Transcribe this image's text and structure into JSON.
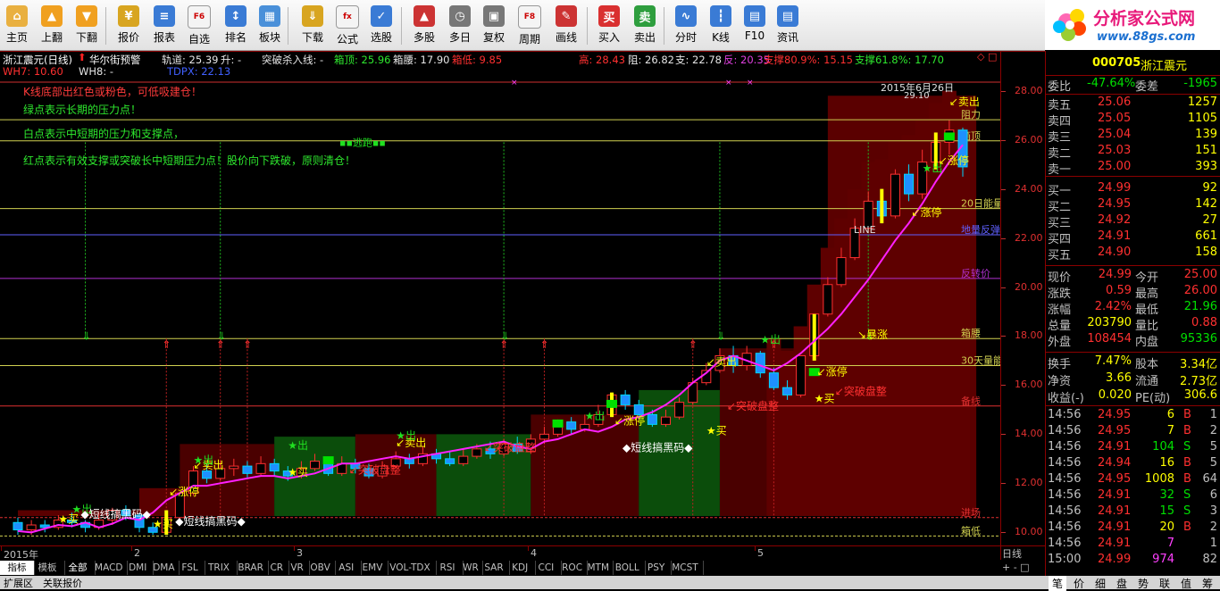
{
  "toolbar": {
    "buttons": [
      {
        "label": "主页",
        "icon": "home-icon",
        "color": "#e9b040",
        "glyph": "⌂"
      },
      {
        "label": "上翻",
        "icon": "arrow-up-icon",
        "color": "#f0a020",
        "glyph": "▲"
      },
      {
        "label": "下翻",
        "icon": "arrow-down-icon",
        "color": "#f0a020",
        "glyph": "▼"
      },
      {
        "label": "报价",
        "icon": "price-icon",
        "color": "#d8a520",
        "glyph": "¥"
      },
      {
        "label": "报表",
        "icon": "report-icon",
        "color": "#3a7bd5",
        "glyph": "≡"
      },
      {
        "label": "自选",
        "icon": "f6-icon",
        "color": "#c0c0c0",
        "glyph": "F6"
      },
      {
        "label": "排名",
        "icon": "rank-icon",
        "color": "#3a7bd5",
        "glyph": "↕"
      },
      {
        "label": "板块",
        "icon": "sector-icon",
        "color": "#4a90d9",
        "glyph": "▦"
      },
      {
        "label": "下载",
        "icon": "download-icon",
        "color": "#d8a520",
        "glyph": "⇓"
      },
      {
        "label": "公式",
        "icon": "formula-icon",
        "color": "#e9b040",
        "glyph": "fx"
      },
      {
        "label": "选股",
        "icon": "stock-picker-icon",
        "color": "#3a7bd5",
        "glyph": "✓"
      },
      {
        "label": "多股",
        "icon": "multi-stock-icon",
        "color": "#cc3333",
        "glyph": "▲"
      },
      {
        "label": "多日",
        "icon": "multi-day-icon",
        "color": "#777777",
        "glyph": "◷"
      },
      {
        "label": "复权",
        "icon": "adjust-icon",
        "color": "#777777",
        "glyph": "▣"
      },
      {
        "label": "周期",
        "icon": "f8-icon",
        "color": "#c0c0c0",
        "glyph": "F8"
      },
      {
        "label": "画线",
        "icon": "draw-line-icon",
        "color": "#cc3333",
        "glyph": "✎"
      },
      {
        "label": "买入",
        "icon": "buy-icon",
        "color": "#d93030",
        "glyph": "买"
      },
      {
        "label": "卖出",
        "icon": "sell-icon",
        "color": "#2e9e3e",
        "glyph": "卖"
      },
      {
        "label": "分时",
        "icon": "intraday-icon",
        "color": "#3a7bd5",
        "glyph": "∿"
      },
      {
        "label": "K线",
        "icon": "kline-icon",
        "color": "#3a7bd5",
        "glyph": "┇"
      },
      {
        "label": "F10",
        "icon": "f10-icon",
        "color": "#3a7bd5",
        "glyph": "▤"
      },
      {
        "label": "资讯",
        "icon": "news-icon",
        "color": "#3a7bd5",
        "glyph": "▤"
      }
    ]
  },
  "logo": {
    "title": "分析家公式网",
    "url": "www.88gs.com"
  },
  "infobar": {
    "stock_title": "浙江震元(日线)",
    "indicator_name": "华尔街预警",
    "track_label": "轨道: 25.39",
    "rise_label": "升: -",
    "break_label": "突破杀入线: -",
    "box_top_label": "箱顶: 25.96",
    "box_waist_label": "箱腰: 17.90",
    "box_bottom_label": "箱低: 9.85",
    "high_label": "高: 28.43",
    "resist_label": "阻: 26.82",
    "support_label": "支: 22.78",
    "rebound_label": "反: 20.35",
    "support80_label": "支撑80.9%: 15.15",
    "support61_label": "支撑61.8%: 17.70",
    "wh7_label": "WH7: 10.60",
    "wh8_label": "WH8: -",
    "tdpx_label": "TDPX: 22.13"
  },
  "notes": [
    {
      "text": "K线底部出红色或粉色，可低吸建仓！",
      "color": "#ff3b3b"
    },
    {
      "text": "绿点表示长期的压力点！",
      "color": "#2ee82e"
    },
    {
      "text": "白点表示中短期的压力和支撑点，",
      "color": "#2ee82e"
    },
    {
      "text": "红点表示有效支撑或突破长中短期压力点！股价向下跌破，原则清仓！",
      "color": "#2ee82e"
    }
  ],
  "chart_data": {
    "type": "candlestick",
    "x_labels": [
      "2015年",
      "2",
      "3",
      "4",
      "5"
    ],
    "ylim": [
      9.5,
      28.5
    ],
    "y_ticks": [
      10.0,
      12.0,
      14.0,
      16.0,
      18.0,
      20.0,
      22.0,
      24.0,
      26.0,
      28.0
    ],
    "date_annotation": "2015年6月26日",
    "date_annotation_value": "29.10",
    "levels": [
      {
        "name": "阻力",
        "value": 26.82,
        "color": "#d0d050"
      },
      {
        "name": "箱顶",
        "value": 25.96,
        "color": "#d0d050"
      },
      {
        "name": "20日能量",
        "value": 23.2,
        "color": "#d0d050"
      },
      {
        "name": "地量反弹",
        "value": 22.13,
        "color": "#6060ff"
      },
      {
        "name": "反转价",
        "value": 20.35,
        "color": "#b030d0"
      },
      {
        "name": "箱腰",
        "value": 17.9,
        "color": "#d0d050"
      },
      {
        "name": "30天量能",
        "value": 16.8,
        "color": "#d0d050"
      },
      {
        "name": "备线",
        "value": 15.15,
        "color": "#e03030"
      },
      {
        "name": "进场",
        "value": 10.6,
        "color": "#e03030"
      },
      {
        "name": "箱低",
        "value": 9.85,
        "color": "#d0d050"
      }
    ],
    "series": [
      {
        "name": "轨道",
        "values": [
          10.05,
          10.0,
          10.15,
          10.3,
          10.25,
          10.4,
          10.2,
          10.35,
          10.6,
          10.5,
          10.8,
          11.3,
          11.6,
          11.9,
          11.9,
          12.0,
          12.1,
          12.2,
          12.3,
          12.3,
          12.2,
          12.3,
          12.4,
          12.6,
          12.8,
          12.8,
          12.9,
          13.0,
          13.1,
          13.0,
          13.1,
          13.2,
          13.3,
          13.4,
          13.5,
          13.6,
          13.7,
          13.5,
          13.4,
          13.7,
          13.8,
          14.0,
          14.2,
          14.1,
          14.3,
          14.6,
          14.7,
          14.9,
          15.2,
          15.6,
          16.1,
          16.5,
          17.0,
          17.2,
          17.0,
          16.8,
          16.6,
          16.9,
          17.3,
          17.8,
          18.3,
          18.9,
          19.6,
          20.3,
          21.1,
          21.9,
          22.6,
          23.4,
          24.3,
          25.1,
          25.8
        ]
      }
    ],
    "candles": [
      [
        10.4,
        10.1,
        10.6,
        9.9
      ],
      [
        10.1,
        10.3,
        10.5,
        9.9
      ],
      [
        10.3,
        10.2,
        10.5,
        10.0
      ],
      [
        10.2,
        10.5,
        10.7,
        10.1
      ],
      [
        10.5,
        10.4,
        10.8,
        10.2
      ],
      [
        10.4,
        10.2,
        10.5,
        10.0
      ],
      [
        10.2,
        10.5,
        10.8,
        10.1
      ],
      [
        10.5,
        10.9,
        11.0,
        10.3
      ],
      [
        10.9,
        10.7,
        11.1,
        10.5
      ],
      [
        10.7,
        10.2,
        10.8,
        10.0
      ],
      [
        10.2,
        10.0,
        10.4,
        9.9
      ],
      [
        10.0,
        10.6,
        10.9,
        9.9
      ],
      [
        10.6,
        11.6,
        11.6,
        10.5
      ],
      [
        11.6,
        12.5,
        12.7,
        11.5
      ],
      [
        12.5,
        12.2,
        12.8,
        12.0
      ],
      [
        12.2,
        12.6,
        12.9,
        12.1
      ],
      [
        12.6,
        12.7,
        13.0,
        12.3
      ],
      [
        12.7,
        12.4,
        12.9,
        12.2
      ],
      [
        12.4,
        12.8,
        13.1,
        12.3
      ],
      [
        12.8,
        12.5,
        13.0,
        12.3
      ],
      [
        12.5,
        12.3,
        12.7,
        12.1
      ],
      [
        12.3,
        12.6,
        12.9,
        12.2
      ],
      [
        12.6,
        12.9,
        13.2,
        12.5
      ],
      [
        12.9,
        12.4,
        13.0,
        12.3
      ],
      [
        12.4,
        12.8,
        13.1,
        12.3
      ],
      [
        12.8,
        12.6,
        13.0,
        12.4
      ],
      [
        12.6,
        12.3,
        12.8,
        12.2
      ],
      [
        12.3,
        12.7,
        12.9,
        12.2
      ],
      [
        12.7,
        13.0,
        13.3,
        12.6
      ],
      [
        13.0,
        12.8,
        13.2,
        12.6
      ],
      [
        12.8,
        13.2,
        13.5,
        12.7
      ],
      [
        13.2,
        13.0,
        13.4,
        12.8
      ],
      [
        13.0,
        12.8,
        13.3,
        12.7
      ],
      [
        12.8,
        13.1,
        13.4,
        12.7
      ],
      [
        13.1,
        13.4,
        13.6,
        13.0
      ],
      [
        13.4,
        13.2,
        13.7,
        13.0
      ],
      [
        13.2,
        13.6,
        13.8,
        13.1
      ],
      [
        13.6,
        13.3,
        13.9,
        13.2
      ],
      [
        13.3,
        13.8,
        14.0,
        13.2
      ],
      [
        13.8,
        14.0,
        14.3,
        13.6
      ],
      [
        14.0,
        14.5,
        14.6,
        13.9
      ],
      [
        14.5,
        14.2,
        14.7,
        14.0
      ],
      [
        14.2,
        14.4,
        14.8,
        14.1
      ],
      [
        14.4,
        14.8,
        15.2,
        14.3
      ],
      [
        14.8,
        15.6,
        15.7,
        14.7
      ],
      [
        15.6,
        15.2,
        15.8,
        15.0
      ],
      [
        15.2,
        14.8,
        15.4,
        14.6
      ],
      [
        14.8,
        14.4,
        15.0,
        14.3
      ],
      [
        14.4,
        14.7,
        15.0,
        14.3
      ],
      [
        14.7,
        15.3,
        15.5,
        14.6
      ],
      [
        15.3,
        16.1,
        16.3,
        15.2
      ],
      [
        16.1,
        16.6,
        16.9,
        16.0
      ],
      [
        16.6,
        17.2,
        17.5,
        16.5
      ],
      [
        17.2,
        16.8,
        17.6,
        16.5
      ],
      [
        16.8,
        17.3,
        17.6,
        16.6
      ],
      [
        17.3,
        16.5,
        17.4,
        16.3
      ],
      [
        16.5,
        15.9,
        16.7,
        15.8
      ],
      [
        15.9,
        15.6,
        16.2,
        15.4
      ],
      [
        15.6,
        17.2,
        17.2,
        15.5
      ],
      [
        17.2,
        18.9,
        18.9,
        17.0
      ],
      [
        18.9,
        20.1,
        20.4,
        18.8
      ],
      [
        20.1,
        21.2,
        21.6,
        20.0
      ],
      [
        21.2,
        22.4,
        22.8,
        21.1
      ],
      [
        22.4,
        23.5,
        23.9,
        22.2
      ],
      [
        23.5,
        22.9,
        24.0,
        22.6
      ],
      [
        22.9,
        24.6,
        24.8,
        22.8
      ],
      [
        24.6,
        23.8,
        25.0,
        23.5
      ],
      [
        23.8,
        25.1,
        25.6,
        23.6
      ],
      [
        25.1,
        25.9,
        26.3,
        24.8
      ],
      [
        25.9,
        26.4,
        26.8,
        25.4
      ],
      [
        26.4,
        24.9,
        26.5,
        24.5
      ]
    ]
  },
  "chart_labels": {
    "escape": "逃跑",
    "line": "LINE",
    "surge": "暴涨",
    "limit_up": "涨停",
    "buy": "买",
    "sell_out": "卖出",
    "out": "出",
    "breakout_low": "突破盘整",
    "short_line": "◆短线搞黑码◆",
    "breakout_high": "突破盘整",
    "date_label": "日线"
  },
  "quote": {
    "code": "000705",
    "name": "浙江震元",
    "weibi_label": "委比",
    "weibi": "-47.64%",
    "weicha_label": "委差",
    "weicha": "-1965",
    "asks": [
      [
        "卖五",
        "25.06",
        "1257"
      ],
      [
        "卖四",
        "25.05",
        "1105"
      ],
      [
        "卖三",
        "25.04",
        "139"
      ],
      [
        "卖二",
        "25.03",
        "151"
      ],
      [
        "卖一",
        "25.00",
        "393"
      ]
    ],
    "bids": [
      [
        "买一",
        "24.99",
        "92"
      ],
      [
        "买二",
        "24.95",
        "142"
      ],
      [
        "买三",
        "24.92",
        "27"
      ],
      [
        "买四",
        "24.91",
        "661"
      ],
      [
        "买五",
        "24.90",
        "158"
      ]
    ],
    "stats": [
      [
        "现价",
        "24.99",
        "今开",
        "25.00"
      ],
      [
        "涨跌",
        "0.59",
        "最高",
        "26.00"
      ],
      [
        "涨幅",
        "2.42%",
        "最低",
        "21.96"
      ],
      [
        "总量",
        "203790",
        "量比",
        "0.88"
      ],
      [
        "外盘",
        "108454",
        "内盘",
        "95336"
      ]
    ],
    "stats2": [
      [
        "换手",
        "7.47%",
        "股本",
        "3.34亿"
      ],
      [
        "净资",
        "3.66",
        "流通",
        "2.73亿"
      ],
      [
        "收益(-)",
        "0.020",
        "PE(动)",
        "306.6"
      ]
    ],
    "ticks": [
      [
        "14:56",
        "24.95",
        "6",
        "B",
        "1"
      ],
      [
        "14:56",
        "24.95",
        "7",
        "B",
        "2"
      ],
      [
        "14:56",
        "24.91",
        "104",
        "S",
        "5"
      ],
      [
        "14:56",
        "24.94",
        "16",
        "B",
        "5"
      ],
      [
        "14:56",
        "24.95",
        "1008",
        "B",
        "64"
      ],
      [
        "14:56",
        "24.91",
        "32",
        "S",
        "6"
      ],
      [
        "14:56",
        "24.91",
        "15",
        "S",
        "3"
      ],
      [
        "14:56",
        "24.91",
        "20",
        "B",
        "2"
      ],
      [
        "14:56",
        "24.91",
        "7",
        "",
        "1"
      ],
      [
        "15:00",
        "24.99",
        "974",
        "",
        "82"
      ]
    ]
  },
  "indicator_tabs": [
    "指标",
    "模板",
    "全部",
    "MACD",
    "DMI",
    "DMA",
    "FSL",
    "TRIX",
    "BRAR",
    "CR",
    "VR",
    "OBV",
    "ASI",
    "EMV",
    "VOL-TDX",
    "RSI",
    "WR",
    "SAR",
    "KDJ",
    "CCI",
    "ROC",
    "MTM",
    "BOLL",
    "PSY",
    "MCST"
  ],
  "extbar": {
    "tab1": "扩展区",
    "tab2": "关联报价"
  },
  "right_tabs": [
    "笔",
    "价",
    "细",
    "盘",
    "势",
    "联",
    "值",
    "筹"
  ],
  "colors": {
    "up": "#ff3030",
    "down": "#00e0e0",
    "bg": "#000000",
    "border": "#8b0000",
    "yellow": "#ffff00",
    "green": "#00e000"
  }
}
